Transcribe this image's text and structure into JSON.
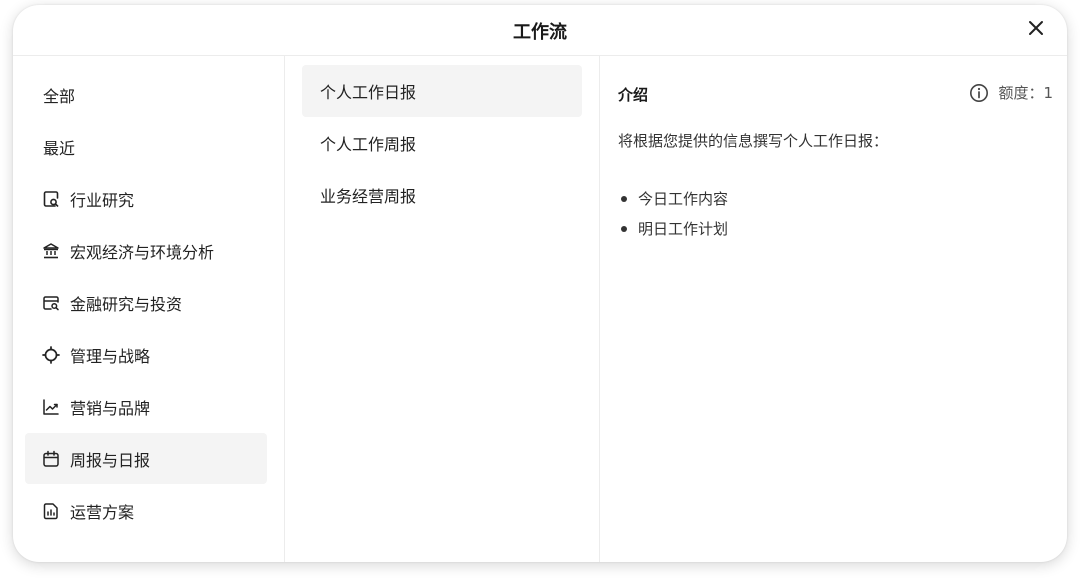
{
  "header": {
    "title": "工作流",
    "close_label": "×"
  },
  "categories": [
    {
      "label": "全部",
      "icon": "none",
      "active": false
    },
    {
      "label": "最近",
      "icon": "none",
      "active": false
    },
    {
      "label": "行业研究",
      "icon": "document-search-icon",
      "active": false
    },
    {
      "label": "宏观经济与环境分析",
      "icon": "bank-icon",
      "active": false
    },
    {
      "label": "金融研究与投资",
      "icon": "card-search-icon",
      "active": false
    },
    {
      "label": "管理与战略",
      "icon": "crosshair-icon",
      "active": false
    },
    {
      "label": "营销与品牌",
      "icon": "trend-chart-icon",
      "active": false
    },
    {
      "label": "周报与日报",
      "icon": "calendar-icon",
      "active": true
    },
    {
      "label": "运营方案",
      "icon": "report-document-icon",
      "active": false
    }
  ],
  "workflows": [
    {
      "label": "个人工作日报",
      "active": true
    },
    {
      "label": "个人工作周报",
      "active": false
    },
    {
      "label": "业务经营周报",
      "active": false
    }
  ],
  "detail": {
    "title": "介绍",
    "quota": "额度：1",
    "description": "将根据您提供的信息撰写个人工作日报：",
    "bullets": [
      "今日工作内容",
      "明日工作计划"
    ]
  }
}
